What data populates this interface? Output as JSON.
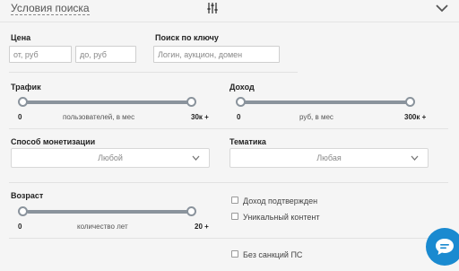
{
  "header": {
    "title": "Условия поиска"
  },
  "price": {
    "label": "Цена",
    "from_placeholder": "от, руб",
    "to_placeholder": "до, руб"
  },
  "keyword": {
    "label": "Поиск по ключу",
    "placeholder": "Логин, аукцион, домен"
  },
  "traffic": {
    "label": "Трафик",
    "min": "0",
    "unit": "пользователей, в мес",
    "max": "30к +"
  },
  "income": {
    "label": "Доход",
    "min": "0",
    "unit": "руб, в мес",
    "max": "300к +"
  },
  "monetization": {
    "label": "Способ монетизации",
    "value": "Любой"
  },
  "topic": {
    "label": "Тематика",
    "value": "Любая"
  },
  "age": {
    "label": "Возраст",
    "min": "0",
    "unit": "количество лет",
    "max": "20 +"
  },
  "checkboxes": {
    "income_confirmed": "Доход подтвержден",
    "unique_content": "Уникальный контент",
    "no_sanctions": "Без санкций ПС"
  },
  "colors": {
    "slider": "#8a939c",
    "chat_button": "#1a8ad0"
  }
}
